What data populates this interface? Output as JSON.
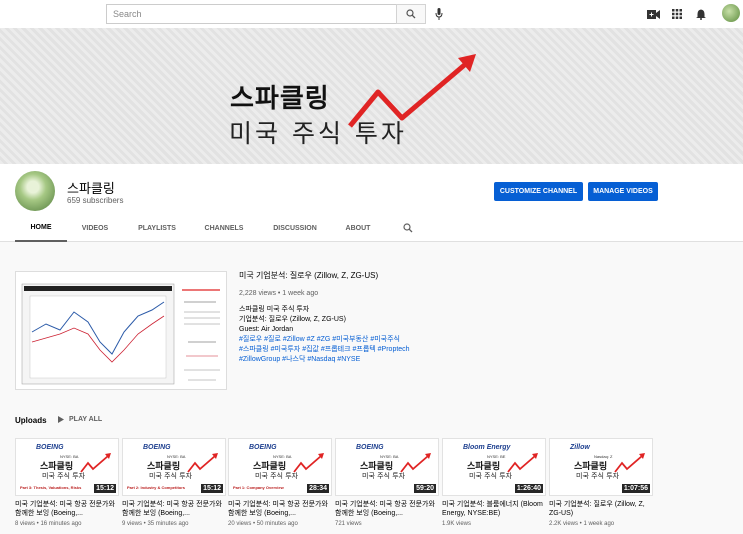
{
  "search": {
    "placeholder": "Search"
  },
  "icons": {
    "search": "search-icon",
    "mic": "mic-icon",
    "create": "video-camera-icon",
    "apps": "apps-grid-icon",
    "notifications": "bell-icon"
  },
  "banner": {
    "title": "스파클링",
    "subtitle": "미국 주식 투자",
    "arrow_color": "#e02424"
  },
  "channel": {
    "name": "스파클링",
    "subscribers": "659 subscribers",
    "customize_label": "CUSTOMIZE CHANNEL",
    "manage_label": "MANAGE VIDEOS",
    "accent": "#065fd4"
  },
  "tabs": [
    {
      "label": "HOME",
      "active": true
    },
    {
      "label": "VIDEOS"
    },
    {
      "label": "PLAYLISTS"
    },
    {
      "label": "CHANNELS"
    },
    {
      "label": "DISCUSSION"
    },
    {
      "label": "ABOUT"
    }
  ],
  "featured": {
    "title": "미국 기업분석: 질로우 (Zillow, Z, ZG-US)",
    "meta": "2,228 views • 1 week ago",
    "lines": [
      "스파클링 미국 주식 투자",
      "기업분석: 질로우 (Zillow, Z, ZG-US)",
      "Guest: Air Jordan"
    ],
    "tags": [
      "#질로우 #질로 #Zillow #Z #ZG #미국부동산 #미국주식",
      "#스파클링 #미국투자 #집값 #프롭테크 #프롭텍 #Proptech",
      "#ZillowGroup #나스닥 #Nasdaq #NYSE"
    ]
  },
  "uploads": {
    "title": "Uploads",
    "play_all": "PLAY ALL",
    "videos": [
      {
        "logo": "BOEING",
        "sub": "NYSE: BA",
        "part": "Part 3: Thesis, Valuations, Risks",
        "duration": "15:12",
        "title": "미국 기업분석: 미국 항공 전문가와 함께한 보잉 (Boeing,...",
        "meta": "8 views • 16 minutes ago"
      },
      {
        "logo": "BOEING",
        "sub": "NYSE: BA",
        "part": "Part 2: Industry & Competitors",
        "duration": "15:12",
        "title": "미국 기업분석: 미국 항공 전문가와 함께한 보잉 (Boeing,...",
        "meta": "9 views • 35 minutes ago"
      },
      {
        "logo": "BOEING",
        "sub": "NYSE: BA",
        "part": "Part 1: Company Overview",
        "duration": "28:34",
        "title": "미국 기업분석: 미국 항공 전문가와 함께한 보잉 (Boeing,...",
        "meta": "20 views • 50 minutes ago"
      },
      {
        "logo": "BOEING",
        "sub": "NYSE: BA",
        "part": "",
        "duration": "59:20",
        "title": "미국 기업분석: 미국 항공 전문가와 함께한 보잉 (Boeing,...",
        "meta": "721 views"
      },
      {
        "logo": "Bloom Energy",
        "sub": "NYSE: BE",
        "part": "",
        "duration": "1:26:40",
        "title": "미국 기업분석: 블룸에너지 (Bloom Energy, NYSE:BE)",
        "meta": "1.9K views"
      },
      {
        "logo": "Zillow",
        "sub": "Nasdaq: Z",
        "part": "",
        "duration": "1:07:56",
        "title": "미국 기업분석: 질로우 (Zillow, Z, ZG-US)",
        "meta": "2.2K views • 1 week ago"
      }
    ]
  }
}
